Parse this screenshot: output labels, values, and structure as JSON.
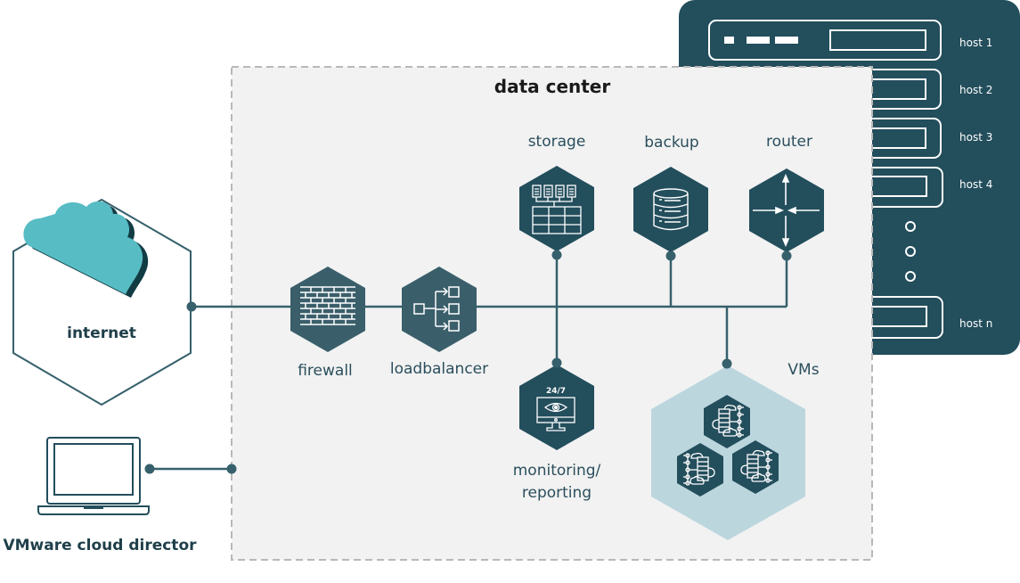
{
  "diagram": {
    "title": "data center",
    "colors": {
      "dark_teal": "#234e5c",
      "mid_teal": "#3a5f6b",
      "light_teal": "#bcd6de",
      "cloud": "#57bcc4",
      "panel_bg": "#f2f2f2",
      "dashed_border": "#b8b8b8"
    },
    "host_rack": {
      "hosts": [
        "host 1",
        "host 2",
        "host 3",
        "host 4",
        "host n"
      ],
      "ellipsis_dots": 3
    },
    "nodes": {
      "internet": {
        "label": "internet",
        "icon": "cloud-icon"
      },
      "firewall": {
        "label": "firewall",
        "icon": "brick-wall-icon"
      },
      "loadbalancer": {
        "label": "loadbalancer",
        "icon": "load-balancer-icon"
      },
      "storage": {
        "label": "storage",
        "icon": "storage-array-icon"
      },
      "backup": {
        "label": "backup",
        "icon": "database-icon"
      },
      "router": {
        "label": "router",
        "icon": "router-arrows-icon"
      },
      "monitoring": {
        "label_line1": "monitoring/",
        "label_line2": "reporting",
        "icon": "monitor-eye-icon",
        "badge": "24/7"
      },
      "vms": {
        "label": "VMs",
        "icon": "virtual-machine-icon",
        "count": 3
      },
      "cloud_director": {
        "label": "VMware cloud director",
        "icon": "laptop-icon"
      }
    },
    "connections": [
      [
        "internet",
        "firewall"
      ],
      [
        "firewall",
        "loadbalancer"
      ],
      [
        "loadbalancer",
        "backbone"
      ],
      [
        "storage",
        "backbone"
      ],
      [
        "backup",
        "backbone"
      ],
      [
        "router",
        "backbone"
      ],
      [
        "storage",
        "monitoring"
      ],
      [
        "backbone",
        "vms"
      ],
      [
        "cloud_director",
        "data center"
      ]
    ]
  }
}
